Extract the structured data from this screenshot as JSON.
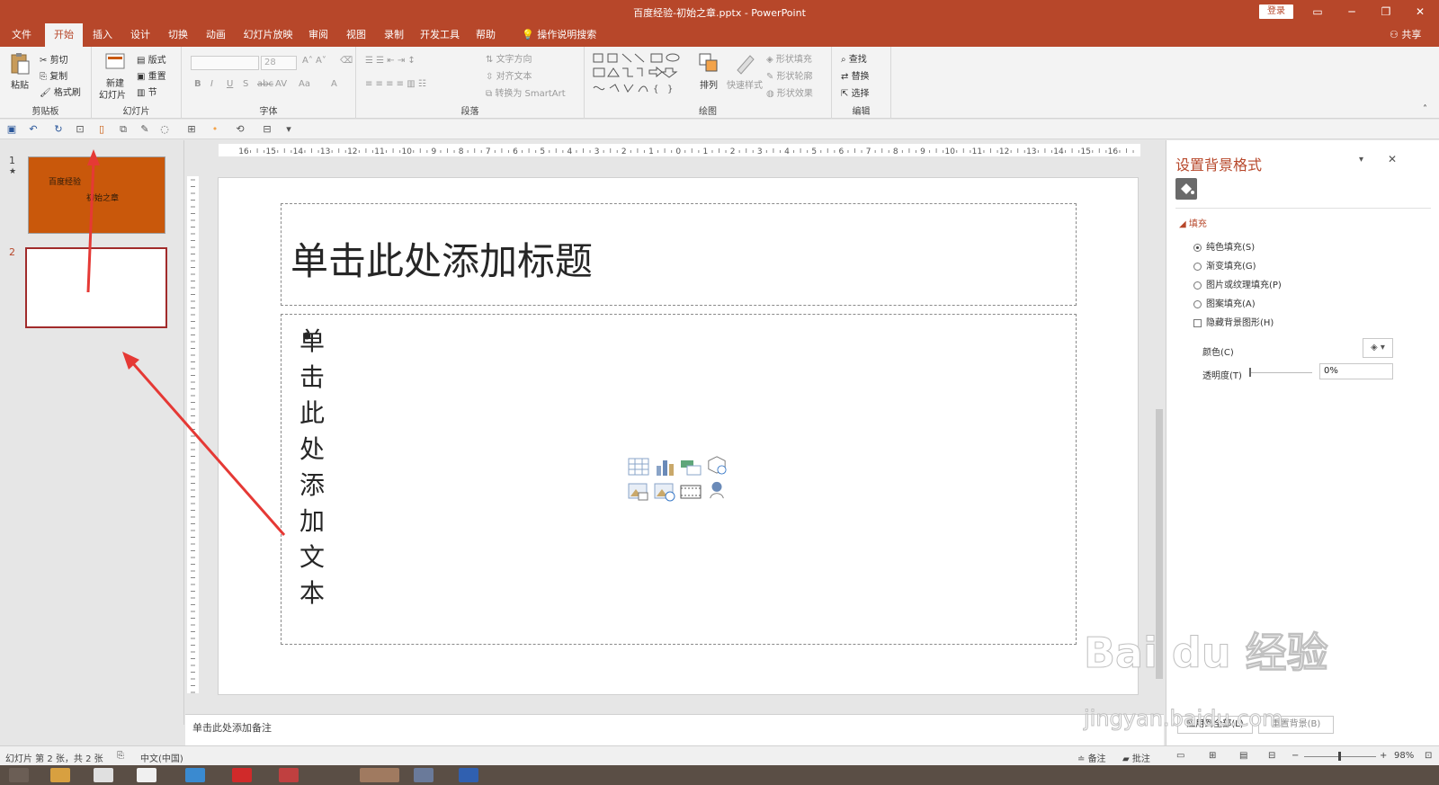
{
  "window": {
    "title": "百度经验-初始之章.pptx  -  PowerPoint",
    "login_label": "登录",
    "share_label": "共享"
  },
  "tabs": [
    "文件",
    "开始",
    "插入",
    "设计",
    "切换",
    "动画",
    "幻灯片放映",
    "审阅",
    "视图",
    "录制",
    "开发工具",
    "帮助"
  ],
  "active_tab": "开始",
  "tell_me": "操作说明搜索",
  "ribbon": {
    "clipboard": {
      "paste": "粘贴",
      "cut": "剪切",
      "copy": "复制",
      "format_painter": "格式刷",
      "label": "剪贴板"
    },
    "slides": {
      "new_slide_1": "新建",
      "new_slide_2": "幻灯片",
      "layout": "版式",
      "reset": "重置",
      "section": "节",
      "label": "幻灯片"
    },
    "font": {
      "size": "28",
      "label": "字体"
    },
    "paragraph": {
      "text_direction": "文字方向",
      "align_text": "对齐文本",
      "smartart": "转换为 SmartArt",
      "label": "段落"
    },
    "drawing": {
      "arrange": "排列",
      "quick_styles": "快速样式",
      "shape_fill": "形状填充",
      "shape_outline": "形状轮廓",
      "shape_effects": "形状效果",
      "label": "绘图"
    },
    "editing": {
      "find": "查找",
      "replace": "替换",
      "select": "选择",
      "label": "编辑"
    }
  },
  "thumbnails": {
    "slide1_number": "1",
    "slide1_star": "★",
    "slide1_line1": "百度经验",
    "slide1_line2": "初始之章",
    "slide2_number": "2"
  },
  "slide": {
    "title_placeholder": "单击此处添加标题",
    "body_placeholder": "单击此处添加文本",
    "bullet": "•"
  },
  "notes_placeholder": "单击此处添加备注",
  "format_pane": {
    "title": "设置背景格式",
    "section": "填充",
    "options": [
      {
        "label": "纯色填充(S)",
        "selected": true
      },
      {
        "label": "渐变填充(G)",
        "selected": false
      },
      {
        "label": "图片或纹理填充(P)",
        "selected": false
      },
      {
        "label": "图案填充(A)",
        "selected": false
      }
    ],
    "hide_bg": "隐藏背景图形(H)",
    "color_label": "颜色(C)",
    "transparency_label": "透明度(T)",
    "transparency_value": "0%",
    "apply_all": "应用到全部(L)",
    "reset_bg": "重置背景(B)"
  },
  "status": {
    "slide_info": "幻灯片 第 2 张，共 2 张",
    "language": "中文(中国)",
    "notes": "备注",
    "comments": "批注",
    "zoom": "98%"
  },
  "ruler": {
    "h_ticks": [
      "16",
      "15",
      "14",
      "13",
      "12",
      "11",
      "10",
      "9",
      "8",
      "7",
      "6",
      "5",
      "4",
      "3",
      "2",
      "1",
      "0",
      "1",
      "2",
      "3",
      "4",
      "5",
      "6",
      "7",
      "8",
      "9",
      "10",
      "11",
      "12",
      "13",
      "14",
      "15",
      "16"
    ]
  },
  "watermark": {
    "line1": "Bai du 经验",
    "line2": "jingyan.baidu.com"
  },
  "colors": {
    "accent": "#b7472a",
    "thumb1_bg": "#c9580b",
    "arrow": "#e53935"
  }
}
